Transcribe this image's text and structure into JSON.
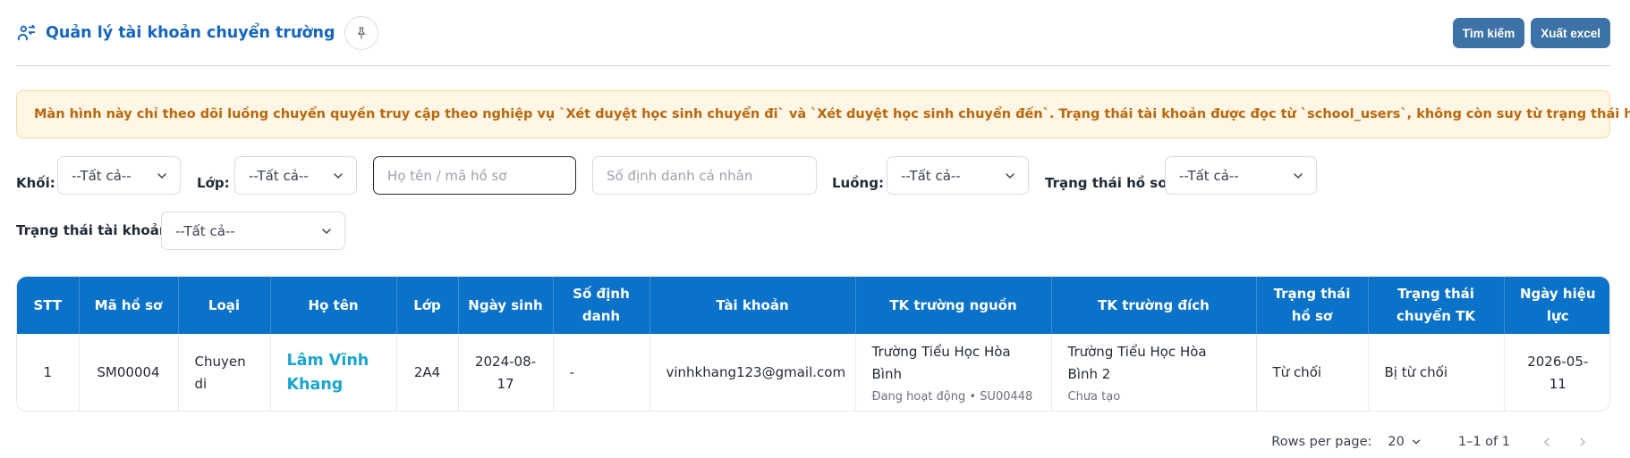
{
  "header": {
    "title": "Quản lý tài khoản chuyển trường",
    "search_button": "Tìm kiếm",
    "export_button": "Xuất excel"
  },
  "notice": {
    "text": "Màn hình này chỉ theo dõi luồng chuyển quyền truy cập theo nghiệp vụ `Xét duyệt học sinh chuyển đi` và `Xét duyệt học sinh chuyển đến`. Trạng thái tài khoản được đọc từ `school_users`, không còn suy từ trạng thái học sinh."
  },
  "filters": {
    "khoi_label": "Khối:",
    "khoi_value": "--Tất cả--",
    "lop_label": "Lớp:",
    "lop_value": "--Tất cả--",
    "name_placeholder": "Họ tên / mã hồ sơ",
    "id_placeholder": "Số định danh cá nhân",
    "luong_label": "Luồng:",
    "luong_value": "--Tất cả--",
    "ho_so_status_label": "Trạng thái hồ sơ:",
    "ho_so_status_value": "--Tất cả--",
    "account_status_label": "Trạng thái tài khoản:",
    "account_status_value": "--Tất cả--"
  },
  "table": {
    "headers": {
      "stt": "STT",
      "ma_ho_so": "Mã hồ sơ",
      "loai": "Loại",
      "ho_ten": "Họ tên",
      "lop": "Lớp",
      "ngay_sinh": "Ngày sinh",
      "so_dinh_danh": "Số định danh",
      "tai_khoan": "Tài khoản",
      "tk_nguon": "TK trường nguồn",
      "tk_dich": "TK trường đích",
      "trang_thai_ho_so": "Trạng thái hồ sơ",
      "trang_thai_tk": "Trạng thái chuyển TK",
      "ngay_hieu_luc": "Ngày hiệu lực"
    },
    "rows": [
      {
        "stt": "1",
        "ma_ho_so": "SM00004",
        "loai": "Chuyen di",
        "ho_ten": "Lâm Vĩnh Khang",
        "lop": "2A4",
        "ngay_sinh": "2024-08-17",
        "so_dinh_danh": "-",
        "tai_khoan": "vinhkhang123@gmail.com",
        "tk_nguon": "Trường Tiểu Học Hòa Bình",
        "tk_nguon_sub": "Đang hoạt động • SU00448",
        "tk_dich": "Trường Tiểu Học Hòa Bình 2",
        "tk_dich_sub": "Chưa tạo",
        "trang_thai_ho_so": "Từ chối",
        "trang_thai_tk": "Bị từ chối",
        "ngay_hieu_luc": "2026-05-11"
      }
    ]
  },
  "pagination": {
    "rows_per_page_label": "Rows per page:",
    "rows_per_page_value": "20",
    "range": "1–1 of 1"
  },
  "colors": {
    "primary": "#1565c0",
    "button_bg": "#3d72a6",
    "table_header": "#0a72c9",
    "notice_bg": "#fff6e6",
    "notice_text": "#b9670b",
    "name_link": "#1aa5cf"
  },
  "icons": {
    "title": "users-swap-icon",
    "pin": "pin-icon",
    "dropdown": "chevron-down-icon",
    "prev": "chevron-left-icon",
    "next": "chevron-right-icon"
  }
}
